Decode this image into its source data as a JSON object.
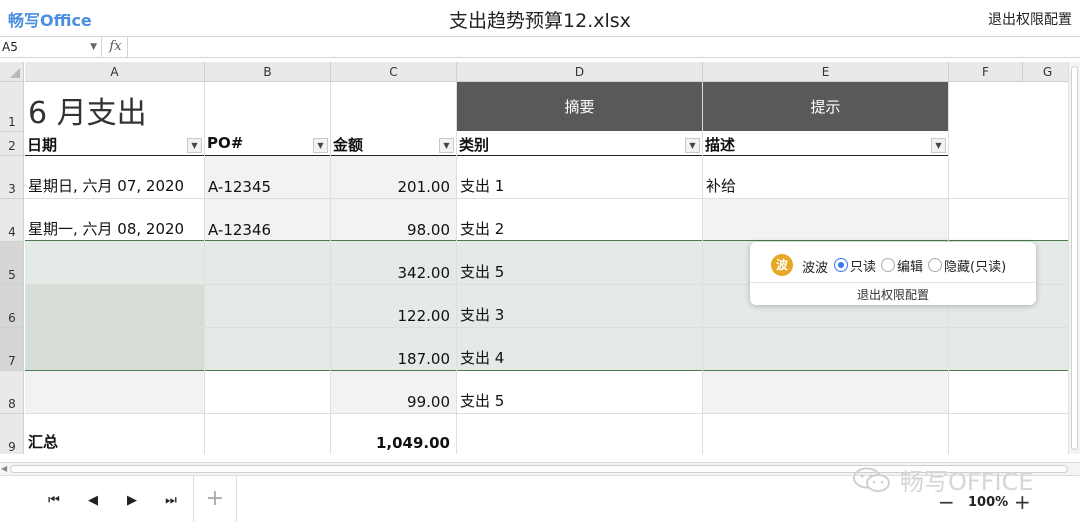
{
  "app": {
    "logo": "畅写Office",
    "doc_title": "支出趋势预算12.xlsx",
    "exit_permissions": "退出权限配置"
  },
  "formula_bar": {
    "name_box": "A5",
    "fx_label": "fx",
    "formula": ""
  },
  "columns": [
    "A",
    "B",
    "C",
    "D",
    "E",
    "F",
    "G"
  ],
  "rows": [
    "1",
    "2",
    "3",
    "4",
    "5",
    "6",
    "7",
    "8",
    "9"
  ],
  "sheet": {
    "title": "6 月支出",
    "band_headers": {
      "summary": "摘要",
      "hint": "提示"
    },
    "field_headers": [
      "日期",
      "PO#",
      "金额",
      "类别",
      "描述"
    ],
    "records": [
      {
        "date": "星期日, 六月 07, 2020",
        "po": "A-12345",
        "amount": "201.00",
        "category": "支出 1",
        "desc": "补给"
      },
      {
        "date": "星期一, 六月 08, 2020",
        "po": "A-12346",
        "amount": "98.00",
        "category": "支出 2",
        "desc": ""
      },
      {
        "date": "",
        "po": "",
        "amount": "342.00",
        "category": "支出 5",
        "desc": ""
      },
      {
        "date": "",
        "po": "",
        "amount": "122.00",
        "category": "支出 3",
        "desc": ""
      },
      {
        "date": "",
        "po": "",
        "amount": "187.00",
        "category": "支出 4",
        "desc": ""
      },
      {
        "date": "",
        "po": "",
        "amount": "99.00",
        "category": "支出 5",
        "desc": ""
      }
    ],
    "total_label": "汇总",
    "total_value": "1,049.00"
  },
  "popup": {
    "avatar_char": "波",
    "user": "波波",
    "options": [
      "只读",
      "编辑",
      "隐藏(只读)"
    ],
    "selected": "只读",
    "exit": "退出权限配置"
  },
  "bottom": {
    "add_sheet": "+",
    "zoom": "100%",
    "zoom_minus": "−",
    "zoom_plus": "+"
  },
  "watermark": "畅写OFFICE",
  "colors": {
    "header_band": "#595959",
    "selection_band": "#dde6df",
    "accent": "#3478f6",
    "avatar": "#e7a722",
    "logo": "#4a8fe0"
  }
}
